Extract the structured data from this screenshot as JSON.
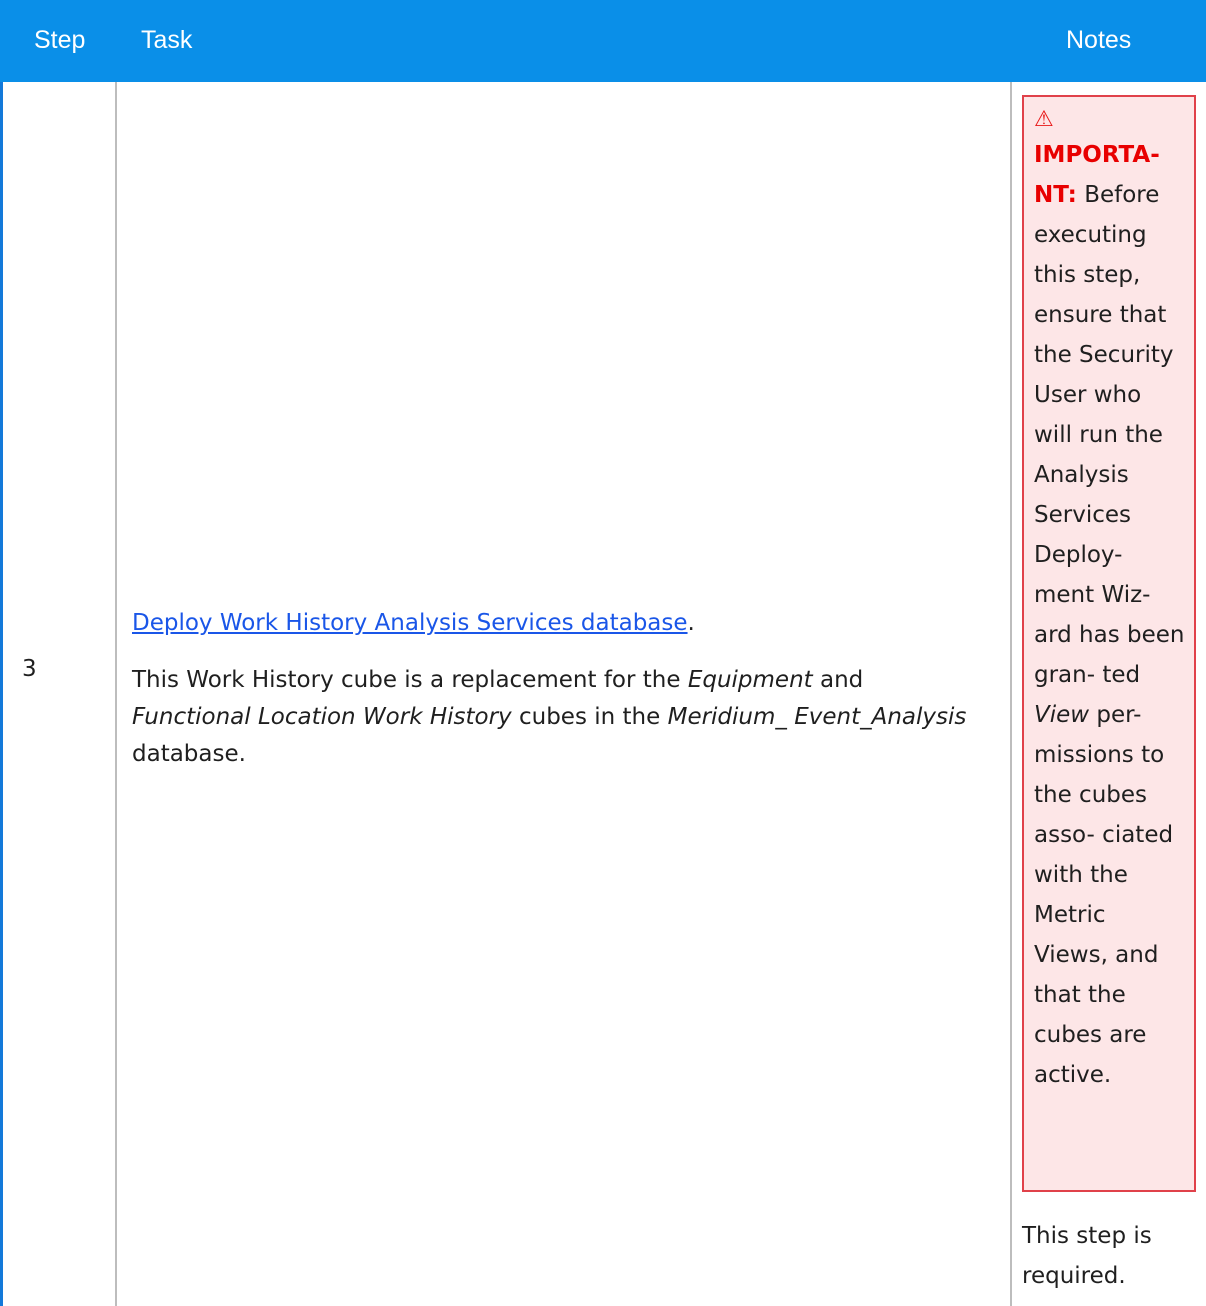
{
  "header": {
    "step": "Step",
    "task": "Task",
    "notes": "Notes"
  },
  "row": {
    "step": "3",
    "task_link": "Deploy Work History Analysis Services database",
    "task_link_suffix": ".",
    "task_desc": {
      "t1": "This Work History cube is a replacement for the ",
      "i1": "Equipment",
      "t2": " and ",
      "i2": "Functional Location Work History",
      "t3": " cubes in the ",
      "i3": "Meridium_ Event_Analysis",
      "t4": " database."
    },
    "note": {
      "icon": "warning-icon",
      "label": "IMPORTA- NT:",
      "t1": " Before executing this step, ensure that the Security User who will run the Analysis Services Deploy- ment Wiz- ard has been gran- ted ",
      "i1": "View",
      "t2": " per- missions to the cubes asso- ciated with the Metric Views, and that the cubes are active."
    },
    "required": "This step is required."
  },
  "colors": {
    "header_bg": "#0a8fe8",
    "link": "#1a56e8",
    "important": "#e80000",
    "note_bg": "#fde6e7",
    "note_border": "#e0414a"
  }
}
